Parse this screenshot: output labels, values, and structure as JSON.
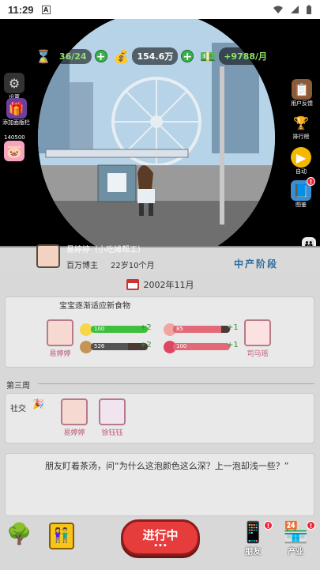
{
  "statusbar": {
    "time": "11:29",
    "a_icon": "A",
    "wifi_icon": "wifi-icon",
    "signal_icon": "signal-icon",
    "battery_icon": "battery-icon"
  },
  "hud": {
    "energy": "36/24",
    "money": "154.6万",
    "income": "+9788/月",
    "icons": [
      "hourglass-icon",
      "money-bag-icon",
      "cash-stack-icon"
    ]
  },
  "left_menu": [
    {
      "label": "设置",
      "icon": "gear-icon"
    },
    {
      "label": "添加面版栏",
      "icon": "gift-icon"
    },
    {
      "label": "140500",
      "icon": "piggy-bank-icon"
    }
  ],
  "right_menu": [
    {
      "label": "用户反馈",
      "icon": "feedback-icon"
    },
    {
      "label": "排行榜",
      "icon": "trophy-icon"
    },
    {
      "label": "自动",
      "icon": "play-icon"
    },
    {
      "label": "图鉴",
      "icon": "book-icon"
    }
  ],
  "profile": {
    "name": "易婷婷（小吃摊帮工）",
    "title": "百万博主",
    "age": "22岁10个月",
    "stage": "中产阶段"
  },
  "date": "2002年11月",
  "event1": {
    "headline": "宝宝逐渐适应新食物",
    "left_person": "易婷婷",
    "right_person": "司马瑶",
    "stats": [
      {
        "icon": "smile-icon",
        "value": "100",
        "delta": "+2",
        "color": "#3ec03e",
        "fill": 1.0
      },
      {
        "icon": "gift-icon",
        "value": "526",
        "delta": "+2",
        "color": "#555555",
        "fill": 0.65
      },
      {
        "icon": "pig-icon",
        "value": "85",
        "delta": "+1",
        "color": "#e26a78",
        "fill": 0.85
      },
      {
        "icon": "heart-icon",
        "value": "100",
        "delta": "+1",
        "color": "#e26a78",
        "fill": 1.0
      }
    ]
  },
  "week_label": "第三周",
  "social": {
    "label": "社交",
    "people": [
      "易婷婷",
      "徐钰钰"
    ]
  },
  "dialog": "朋友盯着茶汤，问“为什么这泡颜色这么深？上一泡却浅一些？”",
  "bottom": {
    "go_label": "进行中",
    "go_dots": "•••",
    "friends_label": "朋友",
    "industry_label": "产业"
  }
}
